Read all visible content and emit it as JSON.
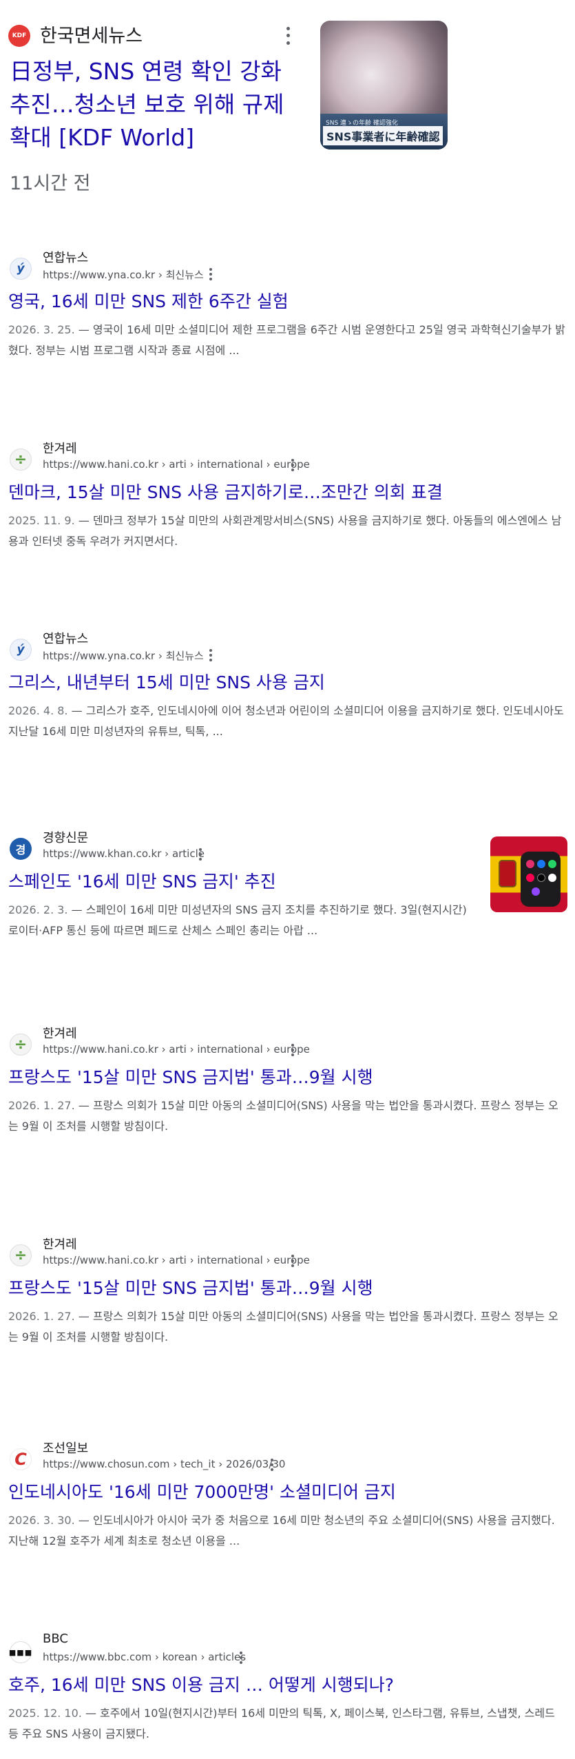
{
  "top_news": {
    "source_logo_text": "KDF",
    "source": "한국면세뉴스",
    "title": "日정부, SNS 연령 확인 강화 추진…청소년 보호 위해 규제 확대 [KDF World]",
    "time": "11시간 전",
    "thumbnail_caption": "SNS事業者に年齢確認",
    "thumbnail_subcaption": "SNS 連ゝの年齢 確認強化"
  },
  "results": [
    {
      "site_name": "연합뉴스",
      "url": "https://www.yna.co.kr › 최신뉴스",
      "title": "영국, 16세 미만 SNS 제한 6주간 실험",
      "date": "2026. 3. 25.",
      "snippet": "영국이 16세 미만 소셜미디어 제한 프로그램을 6주간 시범 운영한다고 25일 영국 과학혁신기술부가 밝혔다. 정부는 시범 프로그램 시작과 종료 시점에 ..."
    },
    {
      "site_name": "한겨레",
      "url": "https://www.hani.co.kr › arti › international › europe",
      "title": "덴마크, 15살 미만 SNS 사용 금지하기로…조만간 의회 표결",
      "date": "2025. 11. 9.",
      "snippet": "덴마크 정부가 15살 미만의 사회관계망서비스(SNS) 사용을 금지하기로 했다. 아동들의 에스엔에스 남용과 인터넷 중독 우려가 커지면서다."
    },
    {
      "site_name": "연합뉴스",
      "url": "https://www.yna.co.kr › 최신뉴스",
      "title": "그리스, 내년부터 15세 미만 SNS 사용 금지",
      "date": "2026. 4. 8.",
      "snippet": "그리스가 호주, 인도네시아에 이어 청소년과 어린이의 소셜미디어 이용을 금지하기로 했다. 인도네시아도 지난달 16세 미만 미성년자의 유튜브, 틱톡, ..."
    },
    {
      "site_name": "경향신문",
      "url": "https://www.khan.co.kr › article",
      "title": "스페인도 '16세 미만 SNS 금지' 추진",
      "date": "2026. 2. 3.",
      "snippet": "스페인이 16세 미만 미성년자의 SNS 금지 조치를 추진하기로 했다. 3일(현지시간) 로이터·AFP 통신 등에 따르면 페드로 산체스 스페인 총리는 아랍 ..."
    },
    {
      "site_name": "한겨레",
      "url": "https://www.hani.co.kr › arti › international › europe",
      "title": "프랑스도 '15살 미만 SNS 금지법' 통과…9월 시행",
      "date": "2026. 1. 27.",
      "snippet": "프랑스 의회가 15살 미만 아동의 소셜미디어(SNS) 사용을 막는 법안을 통과시켰다. 프랑스 정부는 오는 9월 이 조처를 시행할 방침이다."
    },
    {
      "site_name": "한겨레",
      "url": "https://www.hani.co.kr › arti › international › europe",
      "title": "프랑스도 '15살 미만 SNS 금지법' 통과…9월 시행",
      "date": "2026. 1. 27.",
      "snippet": "프랑스 의회가 15살 미만 아동의 소셜미디어(SNS) 사용을 막는 법안을 통과시켰다. 프랑스 정부는 오는 9월 이 조처를 시행할 방침이다."
    },
    {
      "site_name": "조선일보",
      "url": "https://www.chosun.com › tech_it › 2026/03/30",
      "title": "인도네시아도 '16세 미만 7000만명' 소셜미디어 금지",
      "date": "2026. 3. 30.",
      "snippet": "인도네시아가 아시아 국가 중 처음으로 16세 미만 청소년의 주요 소셜미디어(SNS) 사용을 금지했다. 지난해 12월 호주가 세계 최초로 청소년 이용을 ..."
    },
    {
      "site_name": "BBC",
      "url": "https://www.bbc.com › korean › articles",
      "title": "호주, 16세 미만 SNS 이용 금지 … 어떻게 시행되나?",
      "date": "2025. 12. 10.",
      "snippet": "호주에서 10일(현지시간)부터 16세 미만의 틱톡, X, 페이스북, 인스타그램, 유튜브, 스냅챗, 스레드 등 주요 SNS 사용이 금지됐다."
    }
  ],
  "favicons": {
    "yna": "ý",
    "hani": "÷",
    "khan": "경",
    "chosun": "C",
    "bbc": "■■■"
  },
  "date_separator": " — ",
  "colors": {
    "title_link": "#1a0dab",
    "snippet_text": "#4d5156",
    "date_text": "#70757a",
    "kdf_logo": "#e53935"
  }
}
